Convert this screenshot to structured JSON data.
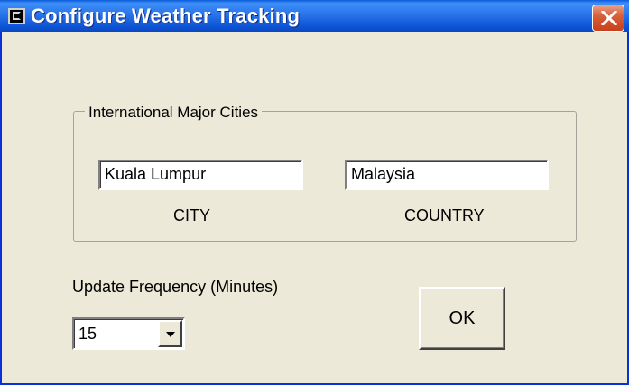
{
  "window": {
    "title": "Configure Weather Tracking"
  },
  "group": {
    "label": "International Major Cities"
  },
  "city": {
    "value": "Kuala Lumpur",
    "caption": "CITY"
  },
  "country": {
    "value": "Malaysia",
    "caption": "COUNTRY"
  },
  "frequency": {
    "label": "Update Frequency (Minutes)",
    "selected": "15"
  },
  "buttons": {
    "ok_label": "OK"
  },
  "icons": {
    "app": "app-icon",
    "close": "close-icon",
    "dropdown": "chevron-down-icon"
  },
  "colors": {
    "titlebar": "#2a74ea",
    "close_button": "#d8603a",
    "dialog_background": "#ece9d8"
  }
}
